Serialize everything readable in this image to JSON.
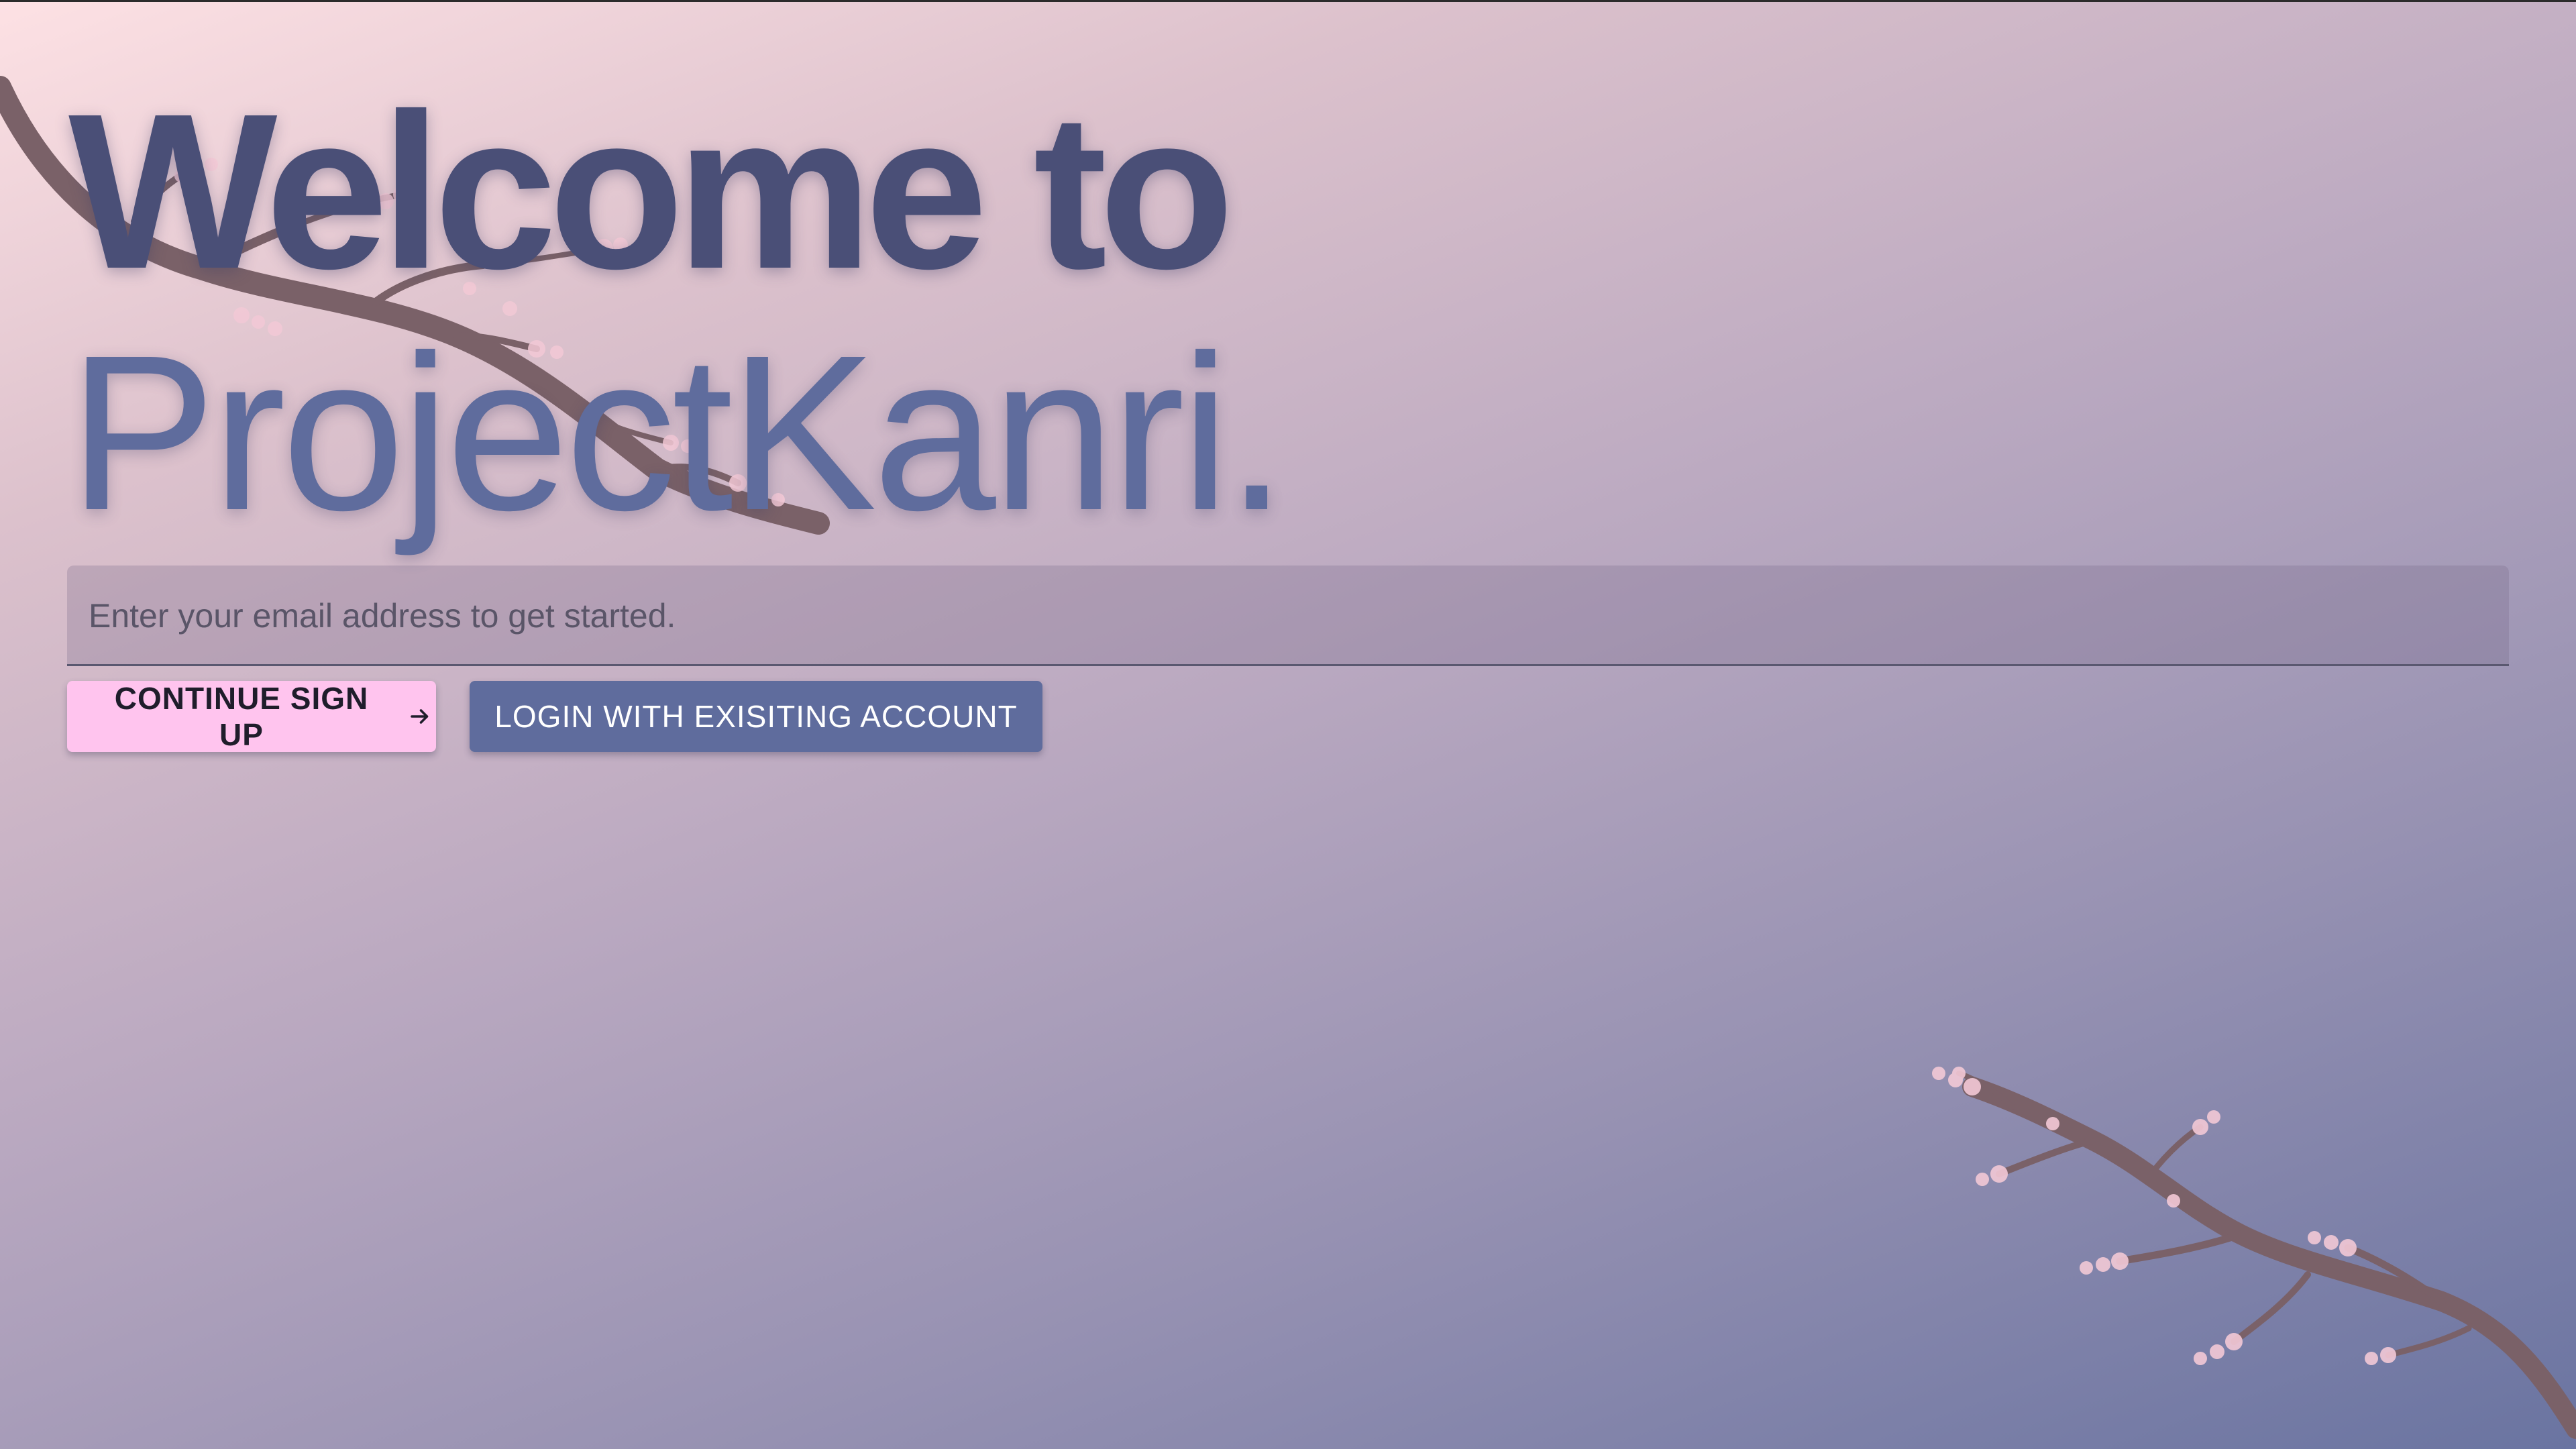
{
  "hero": {
    "line1": "Welcome to",
    "line2": "ProjectKanri."
  },
  "email": {
    "placeholder": "Enter your email address to get started.",
    "value": ""
  },
  "buttons": {
    "signup_label": "CONTINUE SIGN UP",
    "signup_icon": "arrow-right-icon",
    "login_label": "LOGIN WITH EXISITING ACCOUNT"
  },
  "decor": {
    "branch_icon": "cherry-blossom-branch",
    "colors": {
      "title_dark": "#4a4f77",
      "title_accent": "#5f6c9d",
      "signup_bg": "#ffc4ee",
      "login_bg": "#5f6c9d",
      "branch": "#7a6168",
      "blossom": "#f3c9d6"
    }
  }
}
